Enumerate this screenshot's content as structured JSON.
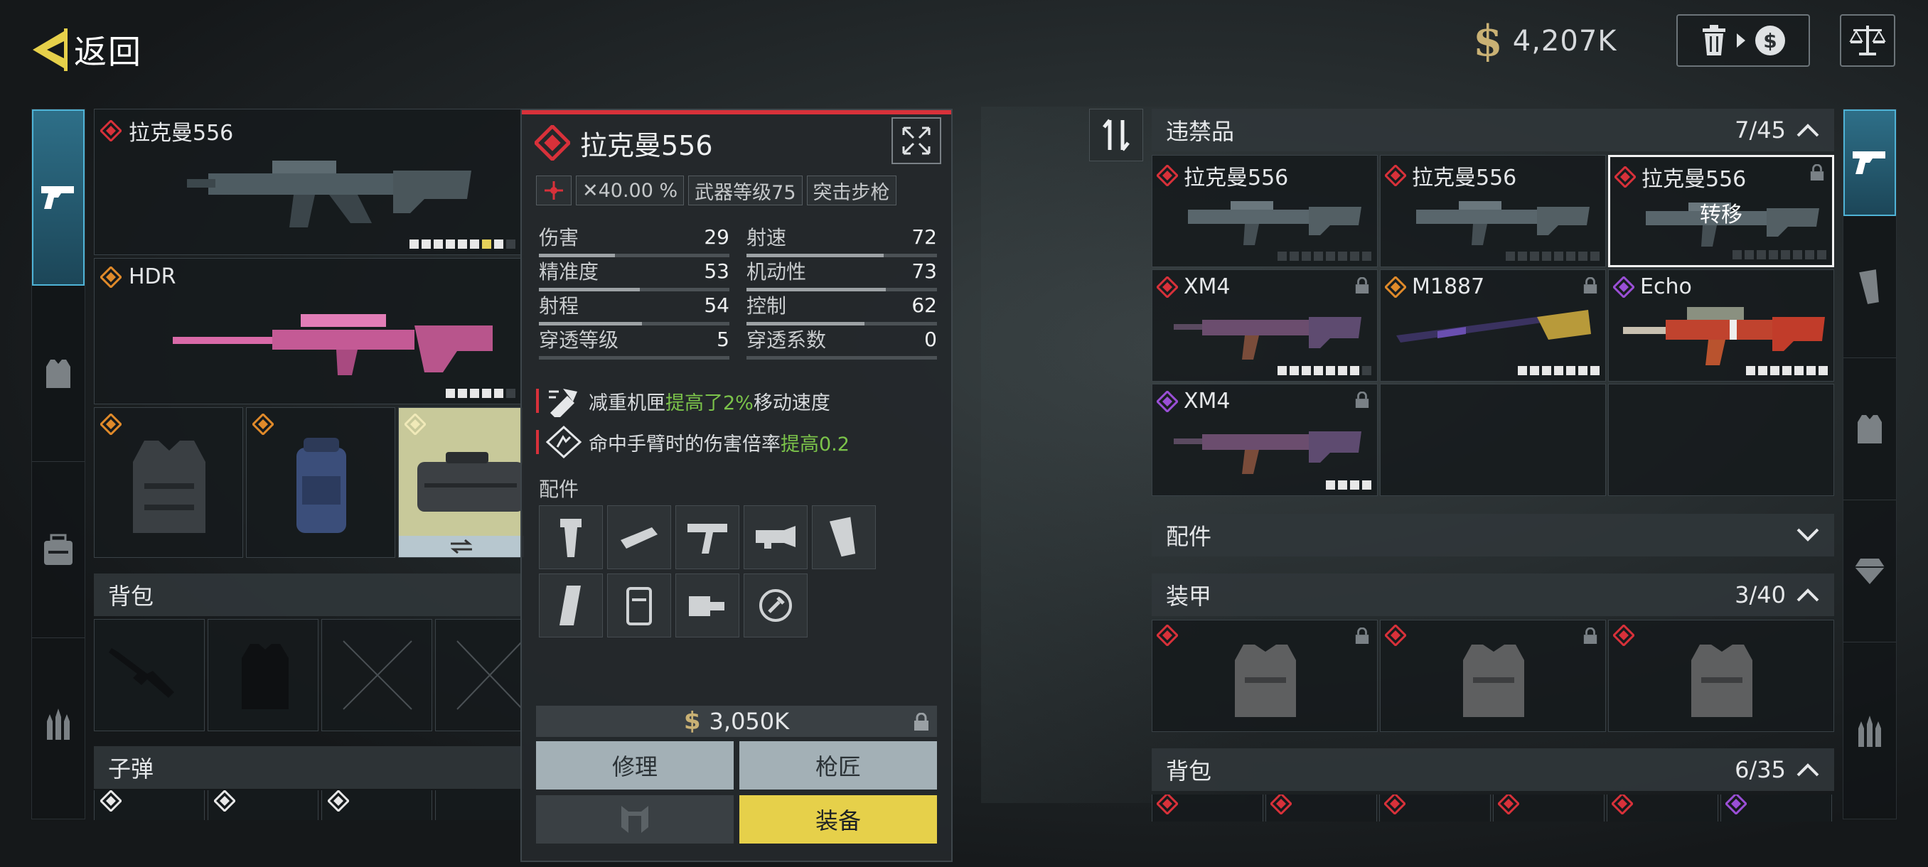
{
  "header": {
    "back_label": "返回",
    "currency_symbol": "$",
    "money": "4,207K"
  },
  "left_loadout": {
    "primary": {
      "name": "拉克曼556"
    },
    "secondary": {
      "name": "HDR"
    },
    "backpack_title": "背包",
    "ammo_title": "子弹"
  },
  "detail": {
    "weapon_name": "拉克曼556",
    "tags": [
      "✕40.00 %",
      "武器等级75",
      "突击步枪"
    ],
    "stats": [
      {
        "label": "伤害",
        "value": "29",
        "fill": 0.4
      },
      {
        "label": "射速",
        "value": "72",
        "fill": 0.72
      },
      {
        "label": "精准度",
        "value": "53",
        "fill": 0.53
      },
      {
        "label": "机动性",
        "value": "73",
        "fill": 0.73
      },
      {
        "label": "射程",
        "value": "54",
        "fill": 0.54
      },
      {
        "label": "控制",
        "value": "62",
        "fill": 0.62
      },
      {
        "label": "穿透等级",
        "value": "5",
        "fill": 0
      },
      {
        "label": "穿透系数",
        "value": "0",
        "fill": 0
      }
    ],
    "perk1_prefix": "减重机匣",
    "perk1_hl": "提高了2%",
    "perk1_suffix": "移动速度",
    "perk2_prefix": "命中手臂时的伤害倍率",
    "perk2_hl": "提高0.2",
    "attachments_title": "配件",
    "price": "3,050K",
    "repair_label": "修理",
    "gunsmith_label": "枪匠",
    "equip_label": "装备"
  },
  "stash": {
    "contraband_title": "违禁品",
    "contraband_count": "7/45",
    "weapons": [
      {
        "name": "拉克曼556",
        "rarity": "red"
      },
      {
        "name": "拉克曼556",
        "rarity": "red"
      },
      {
        "name": "拉克曼556",
        "rarity": "red",
        "overlay": "转移"
      },
      {
        "name": "XM4",
        "rarity": "red"
      },
      {
        "name": "M1887",
        "rarity": "orange"
      },
      {
        "name": "Echo",
        "rarity": "purple"
      },
      {
        "name": "XM4",
        "rarity": "purple"
      }
    ],
    "attachments_title": "配件",
    "armor_title": "装甲",
    "armor_count": "3/40",
    "backpack_title": "背包",
    "backpack_count": "6/35"
  },
  "colors": {
    "accent_yellow": "#e6d04a",
    "rarity_red": "#d8313a",
    "rarity_orange": "#e08a2a",
    "rarity_purple": "#9a4fd6",
    "highlight_green": "#7bc34a",
    "tab_blue": "#2e6f88"
  }
}
